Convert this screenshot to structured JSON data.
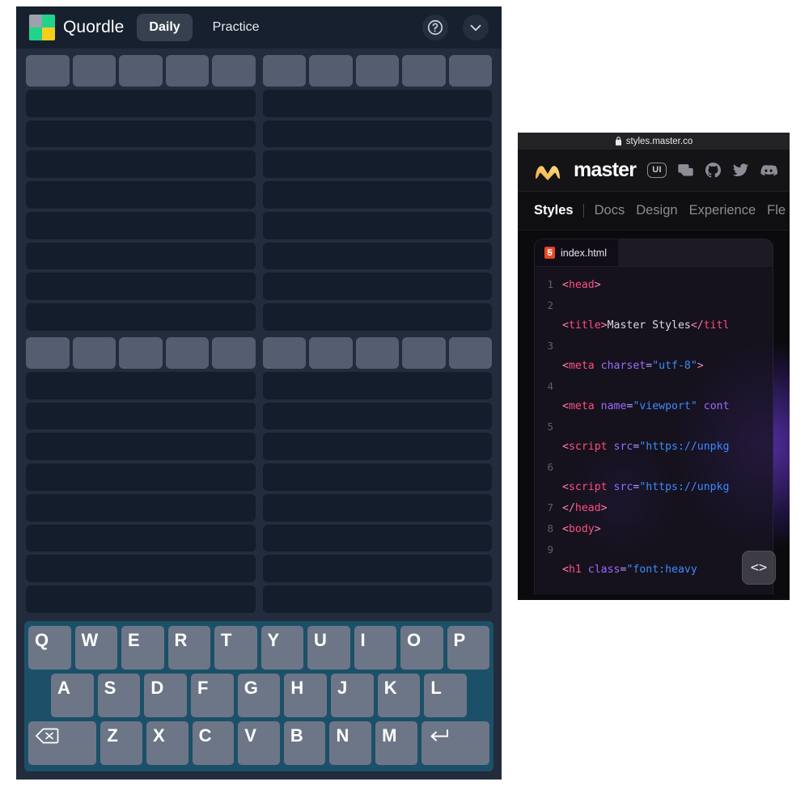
{
  "quordle": {
    "header": {
      "title": "Quordle",
      "logo_colors": [
        "#9aa3ad",
        "#22d38c",
        "#22d38c",
        "#f7ce1c"
      ],
      "logo_icon": "quordle-logo-icon",
      "tabs": [
        {
          "label": "Daily",
          "active": true
        },
        {
          "label": "Practice",
          "active": false
        }
      ],
      "help_icon": "question-mark-circle-icon",
      "menu_icon": "chevron-down-icon"
    },
    "board": {
      "quadrant_count": 4,
      "columns": 5,
      "tile_rows_filled": 1,
      "empty_rows": 8,
      "tile_color": "#545e70",
      "empty_row_color": "#141d2b",
      "board_bg": "#222c3c",
      "quadrants": [
        {
          "name": "quadrant-top-left",
          "rows": [
            [
              "",
              "",
              "",
              "",
              ""
            ]
          ]
        },
        {
          "name": "quadrant-top-right",
          "rows": [
            [
              "",
              "",
              "",
              "",
              ""
            ]
          ]
        },
        {
          "name": "quadrant-bottom-left",
          "rows": [
            [
              "",
              "",
              "",
              "",
              ""
            ]
          ]
        },
        {
          "name": "quadrant-bottom-right",
          "rows": [
            [
              "",
              "",
              "",
              "",
              ""
            ]
          ]
        }
      ]
    },
    "keyboard": {
      "bg_color": "#1b5068",
      "key_color": "#6d7687",
      "row1": [
        "Q",
        "W",
        "E",
        "R",
        "T",
        "Y",
        "U",
        "I",
        "O",
        "P"
      ],
      "row2": [
        "A",
        "S",
        "D",
        "F",
        "G",
        "H",
        "J",
        "K",
        "L"
      ],
      "row3_backspace_icon": "backspace-icon",
      "row3": [
        "Z",
        "X",
        "C",
        "V",
        "B",
        "N",
        "M"
      ],
      "row3_enter_icon": "enter-key-icon"
    }
  },
  "browser": {
    "url": "styles.master.co",
    "lock_icon": "lock-icon",
    "nav": {
      "brand": "master",
      "brand_logo_icon": "master-m-logo-icon",
      "badge": "UI",
      "icons": [
        {
          "name": "chat-bubble-icon"
        },
        {
          "name": "github-icon"
        },
        {
          "name": "twitter-icon"
        },
        {
          "name": "discord-icon"
        }
      ]
    },
    "tabs": [
      {
        "label": "Styles",
        "active": true
      },
      {
        "label": "Docs",
        "active": false
      },
      {
        "label": "Design",
        "active": false
      },
      {
        "label": "Experience",
        "active": false
      },
      {
        "label": "Fle",
        "active": false
      }
    ],
    "editor": {
      "tab_label": "index.html",
      "tab_icon": "html5-file-icon",
      "fab_label": "<>",
      "fab_icon": "code-brackets-icon",
      "lines": [
        {
          "num": "1",
          "tokens": [
            {
              "t": "punct",
              "v": "<"
            },
            {
              "t": "tag",
              "v": "head"
            },
            {
              "t": "punct",
              "v": ">"
            }
          ]
        },
        {
          "num": "2",
          "tokens": []
        },
        {
          "num": "",
          "tokens": [
            {
              "t": "punct",
              "v": "<"
            },
            {
              "t": "tag",
              "v": "title"
            },
            {
              "t": "punct",
              "v": ">"
            },
            {
              "t": "text",
              "v": "Master Styles"
            },
            {
              "t": "punct",
              "v": "</"
            },
            {
              "t": "tag",
              "v": "titl"
            }
          ]
        },
        {
          "num": "3",
          "tokens": []
        },
        {
          "num": "",
          "tokens": [
            {
              "t": "punct",
              "v": "<"
            },
            {
              "t": "tag",
              "v": "meta"
            },
            {
              "t": "text",
              "v": " "
            },
            {
              "t": "attr",
              "v": "charset"
            },
            {
              "t": "eq",
              "v": "="
            },
            {
              "t": "str",
              "v": "\"utf-8\""
            },
            {
              "t": "punct",
              "v": ">"
            }
          ]
        },
        {
          "num": "4",
          "tokens": []
        },
        {
          "num": "",
          "tokens": [
            {
              "t": "punct",
              "v": "<"
            },
            {
              "t": "tag",
              "v": "meta"
            },
            {
              "t": "text",
              "v": " "
            },
            {
              "t": "attr",
              "v": "name"
            },
            {
              "t": "eq",
              "v": "="
            },
            {
              "t": "str",
              "v": "\"viewport\""
            },
            {
              "t": "text",
              "v": " "
            },
            {
              "t": "attr",
              "v": "cont"
            }
          ]
        },
        {
          "num": "5",
          "tokens": []
        },
        {
          "num": "",
          "tokens": [
            {
              "t": "punct",
              "v": "<"
            },
            {
              "t": "tag",
              "v": "script"
            },
            {
              "t": "text",
              "v": " "
            },
            {
              "t": "attr",
              "v": "src"
            },
            {
              "t": "eq",
              "v": "="
            },
            {
              "t": "str",
              "v": "\"https://unpkg"
            }
          ]
        },
        {
          "num": "6",
          "tokens": []
        },
        {
          "num": "",
          "tokens": [
            {
              "t": "punct",
              "v": "<"
            },
            {
              "t": "tag",
              "v": "script"
            },
            {
              "t": "text",
              "v": " "
            },
            {
              "t": "attr",
              "v": "src"
            },
            {
              "t": "eq",
              "v": "="
            },
            {
              "t": "str",
              "v": "\"https://unpkg"
            }
          ]
        },
        {
          "num": "7",
          "tokens": [
            {
              "t": "punct",
              "v": "</"
            },
            {
              "t": "tag",
              "v": "head"
            },
            {
              "t": "punct",
              "v": ">"
            }
          ]
        },
        {
          "num": "8",
          "tokens": [
            {
              "t": "punct",
              "v": "<"
            },
            {
              "t": "tag",
              "v": "body"
            },
            {
              "t": "punct",
              "v": ">"
            }
          ]
        },
        {
          "num": "9",
          "tokens": []
        },
        {
          "num": "",
          "tokens": [
            {
              "t": "punct",
              "v": "<"
            },
            {
              "t": "tag",
              "v": "h1"
            },
            {
              "t": "text",
              "v": " "
            },
            {
              "t": "attr",
              "v": "class"
            },
            {
              "t": "eq",
              "v": "="
            },
            {
              "t": "str",
              "v": "\"font:heavy "
            }
          ]
        }
      ]
    }
  }
}
